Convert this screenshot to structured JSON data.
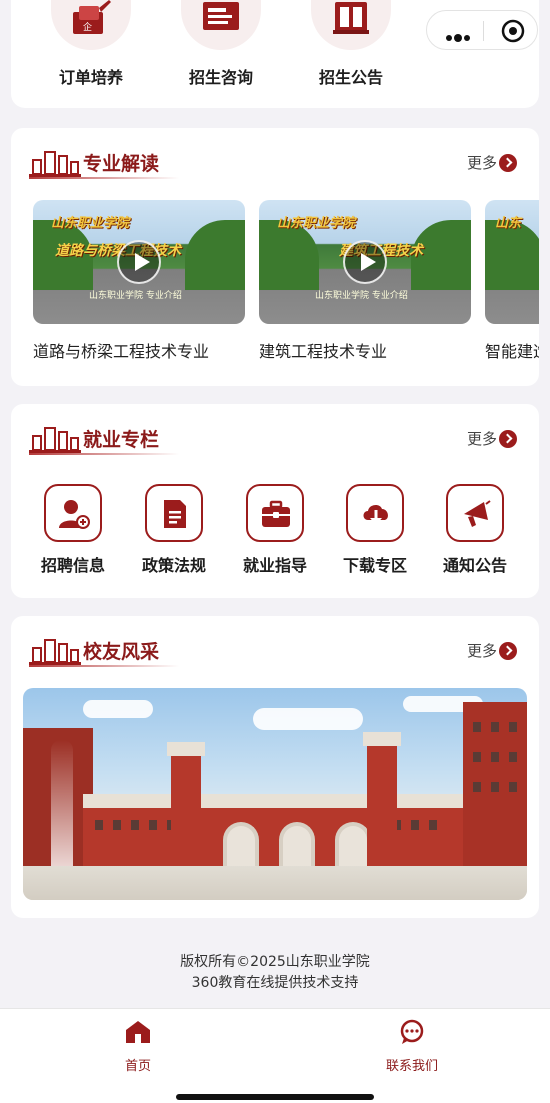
{
  "colors": {
    "accent": "#9b1c1c",
    "title_red": "#8b1a1a",
    "background": "#f3f2f6"
  },
  "top_nav": {
    "items": [
      {
        "label": "订单培养",
        "icon": "order-training-icon"
      },
      {
        "label": "招生咨询",
        "icon": "admission-consult-icon"
      },
      {
        "label": "招生公告",
        "icon": "admission-notice-icon"
      }
    ]
  },
  "capsule": {
    "more_icon": "more-dots-icon",
    "close_icon": "close-target-icon"
  },
  "majors": {
    "title": "专业解读",
    "more": "更多",
    "videos": [
      {
        "title": "道路与桥梁工程技术专业",
        "cap_school": "山东职业学院",
        "cap_major": "道路与桥梁工程技术",
        "cap_sub": "山东职业学院 专业介绍"
      },
      {
        "title": "建筑工程技术专业",
        "cap_school": "山东职业学院",
        "cap_major": "建筑工程技术",
        "cap_sub": "山东职业学院 专业介绍"
      },
      {
        "title": "智能建造",
        "cap_school": "山东",
        "cap_major": "",
        "cap_sub": ""
      }
    ]
  },
  "employment": {
    "title": "就业专栏",
    "more": "更多",
    "items": [
      {
        "label": "招聘信息",
        "icon": "recruit-icon"
      },
      {
        "label": "政策法规",
        "icon": "policy-doc-icon"
      },
      {
        "label": "就业指导",
        "icon": "briefcase-icon"
      },
      {
        "label": "下载专区",
        "icon": "cloud-download-icon"
      },
      {
        "label": "通知公告",
        "icon": "megaphone-icon"
      }
    ]
  },
  "alumni": {
    "title": "校友风采",
    "more": "更多",
    "image": "campus-photo"
  },
  "footer": {
    "copyright": "版权所有©2025山东职业学院",
    "support": "360教育在线提供技术支持"
  },
  "tabbar": {
    "items": [
      {
        "label": "首页",
        "icon": "home-icon"
      },
      {
        "label": "联系我们",
        "icon": "chat-icon"
      }
    ]
  }
}
